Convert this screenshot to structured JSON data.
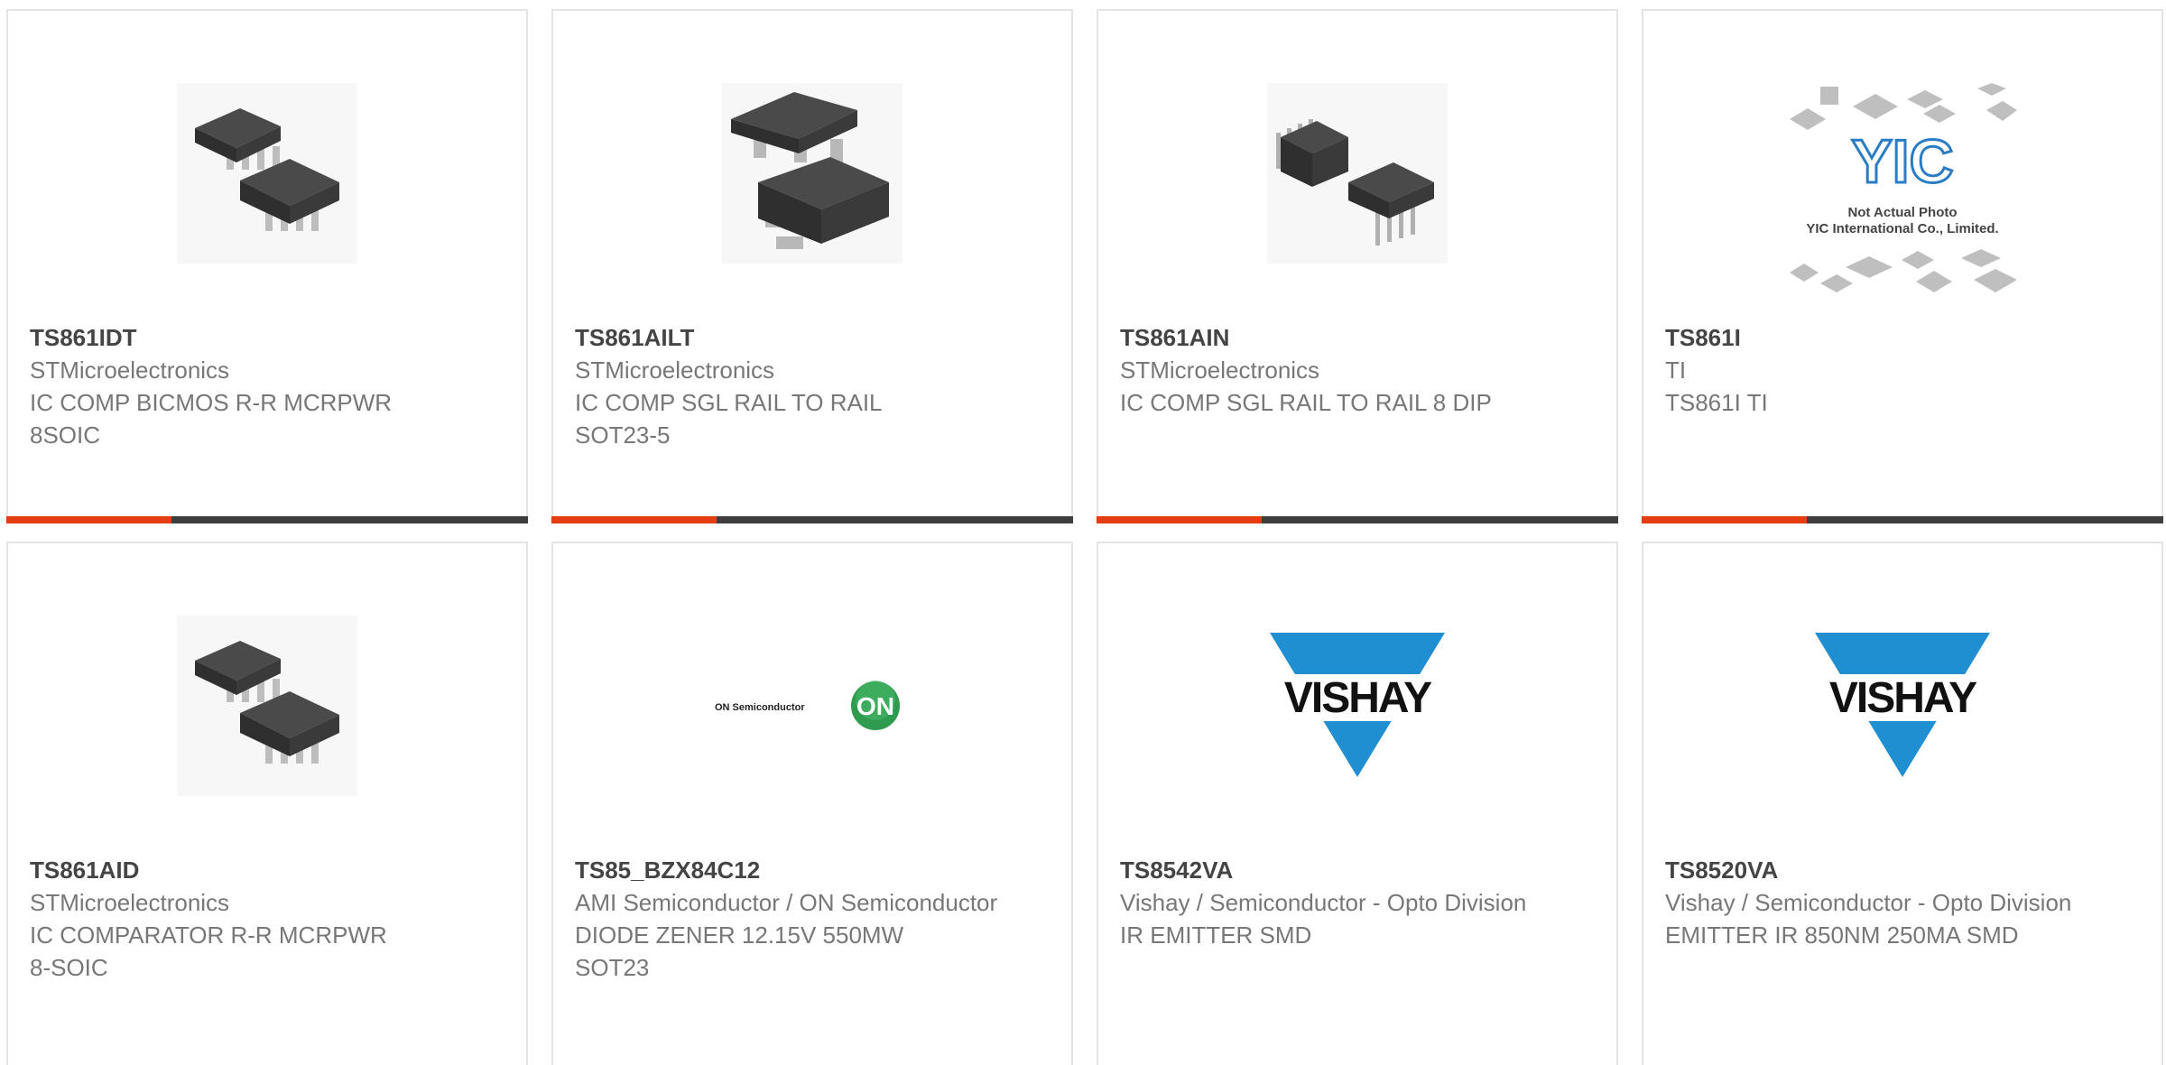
{
  "colors": {
    "accent": "#e43d13",
    "bar": "#3d3d3d",
    "vishay_blue": "#1f8fd2",
    "on_green": "#2e9b4f"
  },
  "products": [
    {
      "part": "TS861IDT",
      "manufacturer": "STMicroelectronics",
      "description": "IC COMP BICMOS R-R MCRPWR 8SOIC",
      "image": "soic8-chip-icon"
    },
    {
      "part": "TS861AILT",
      "manufacturer": "STMicroelectronics",
      "description": "IC COMP SGL RAIL TO RAIL SOT23-5",
      "image": "sot23-chip-icon"
    },
    {
      "part": "TS861AIN",
      "manufacturer": "STMicroelectronics",
      "description": "IC COMP SGL RAIL TO RAIL 8 DIP",
      "image": "dip8-chip-icon"
    },
    {
      "part": "TS861I",
      "manufacturer": "TI",
      "description": "TS861I TI",
      "image": "yic-placeholder-logo",
      "logo_text": {
        "brand": "YIC",
        "line1": "Not Actual Photo",
        "line2": "YIC International Co., Limited."
      }
    },
    {
      "part": "TS861AID",
      "manufacturer": "STMicroelectronics",
      "description": "IC COMPARATOR R-R MCRPWR 8-SOIC",
      "image": "soic8-chip-icon"
    },
    {
      "part": "TS85_BZX84C12",
      "manufacturer": "AMI Semiconductor / ON Semiconductor",
      "description": "DIODE ZENER 12.15V 550MW SOT23",
      "image": "on-semi-logo",
      "logo_text": {
        "name": "ON Semiconductor",
        "badge": "ON"
      }
    },
    {
      "part": "TS8542VA",
      "manufacturer": "Vishay / Semiconductor - Opto Division",
      "description": "IR EMITTER SMD",
      "image": "vishay-logo",
      "logo_text": {
        "name": "VISHAY"
      }
    },
    {
      "part": "TS8520VA",
      "manufacturer": "Vishay / Semiconductor - Opto Division",
      "description": "EMITTER IR 850NM 250MA SMD",
      "image": "vishay-logo",
      "logo_text": {
        "name": "VISHAY"
      }
    }
  ]
}
